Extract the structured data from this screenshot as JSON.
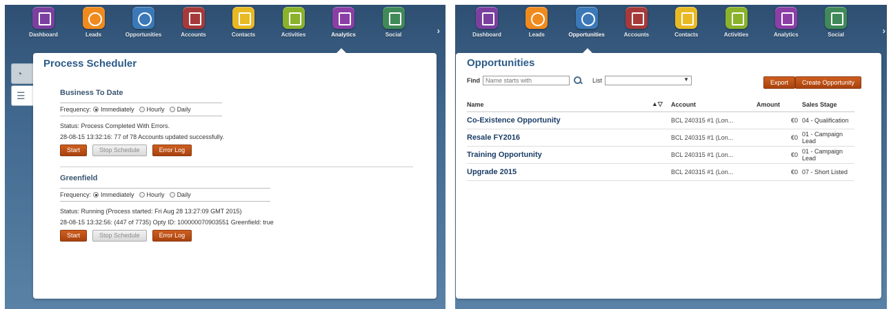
{
  "nav": {
    "items": [
      {
        "label": "Dashboard",
        "color": "#7b3fa0"
      },
      {
        "label": "Leads",
        "color": "#f08a1c"
      },
      {
        "label": "Opportunities",
        "color": "#3b78b8"
      },
      {
        "label": "Accounts",
        "color": "#a63a3a"
      },
      {
        "label": "Contacts",
        "color": "#e8b923"
      },
      {
        "label": "Activities",
        "color": "#8ab22b"
      },
      {
        "label": "Analytics",
        "color": "#8a3ea6"
      },
      {
        "label": "Social",
        "color": "#3f8a58"
      }
    ],
    "more_arrow": "›"
  },
  "left": {
    "active_nav": "Analytics",
    "title": "Process Scheduler",
    "side_tabs": [
      {
        "icon": "gauge-icon"
      },
      {
        "icon": "report-icon"
      }
    ],
    "sections": [
      {
        "title": "Business To Date",
        "frequency_label": "Frequency:",
        "options": [
          "Immediately",
          "Hourly",
          "Daily"
        ],
        "selected": "Immediately",
        "status": "Status: Process Completed With Errors.",
        "detail": "28-08-15 13:32:16: 77 of 78 Accounts updated successfully.",
        "buttons": {
          "start": "Start",
          "stop": "Stop Schedule",
          "log": "Error Log"
        }
      },
      {
        "title": "Greenfield",
        "frequency_label": "Frequency:",
        "options": [
          "Immediately",
          "Hourly",
          "Daily"
        ],
        "selected": "Immediately",
        "status": "Status: Running (Process started: Fri Aug 28 13:27:09 GMT 2015)",
        "detail": "28-08-15 13:32:56: (447 of 7735) Opty ID: 100000070903551 Greenfield: true",
        "buttons": {
          "start": "Start",
          "stop": "Stop Schedule",
          "log": "Error Log"
        }
      }
    ]
  },
  "right": {
    "active_nav": "Opportunities",
    "title": "Opportunities",
    "find_label": "Find",
    "find_placeholder": "Name starts with",
    "list_label": "List",
    "list_caret": "▼",
    "export_label": "Export",
    "create_label": "Create Opportunity",
    "columns": {
      "name": "Name",
      "sort": "▲▽",
      "account": "Account",
      "amount": "Amount",
      "stage": "Sales Stage"
    },
    "rows": [
      {
        "name": "Co-Existence Opportunity",
        "account": "BCL 240315 #1 (Lon...",
        "amount": "€0",
        "stage": "04 - Qualification"
      },
      {
        "name": "Resale FY2016",
        "account": "BCL 240315 #1 (Lon...",
        "amount": "€0",
        "stage": "01 - Campaign Lead"
      },
      {
        "name": "Training Opportunity",
        "account": "BCL 240315 #1 (Lon...",
        "amount": "€0",
        "stage": "01 - Campaign Lead"
      },
      {
        "name": "Upgrade 2015",
        "account": "BCL 240315 #1 (Lon...",
        "amount": "€0",
        "stage": "07 - Short Listed"
      }
    ]
  },
  "colors": {
    "accent_button": "#b94d15",
    "title": "#2b5b87",
    "link": "#1b3d66"
  }
}
